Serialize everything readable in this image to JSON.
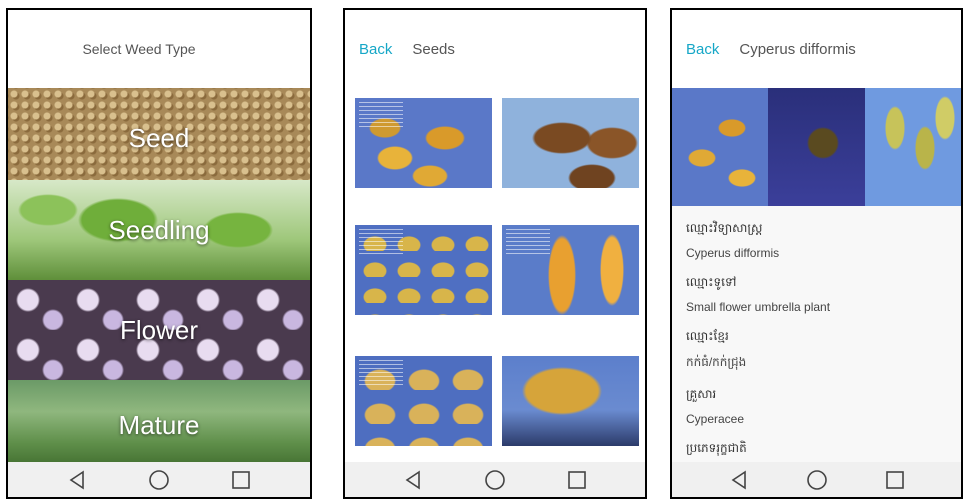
{
  "screen1": {
    "title": "Select Weed Type",
    "categories": [
      {
        "label": "Seed"
      },
      {
        "label": "Seedling"
      },
      {
        "label": "Flower"
      },
      {
        "label": "Mature"
      }
    ]
  },
  "screen2": {
    "back_label": "Back",
    "title": "Seeds",
    "images": 6
  },
  "screen3": {
    "back_label": "Back",
    "title": "Cyperus difformis",
    "fields": [
      {
        "label": "ឈ្មោះវិទ្យាសាស្ត្រ",
        "value": "Cyperus difformis"
      },
      {
        "label": "ឈ្មោះទូទៅ",
        "value": "Small flower umbrella plant"
      },
      {
        "label": "ឈ្មោះខ្មែរ",
        "value": "កក់ធំ/កក់ជ្រុង"
      },
      {
        "label": "គ្រួសារ",
        "value": "Cyperacee"
      },
      {
        "label": "ប្រភេទរុក្ខជាតិ",
        "value": ""
      }
    ]
  },
  "navbar": {
    "back_icon": "triangle-left",
    "home_icon": "circle",
    "recents_icon": "square"
  }
}
